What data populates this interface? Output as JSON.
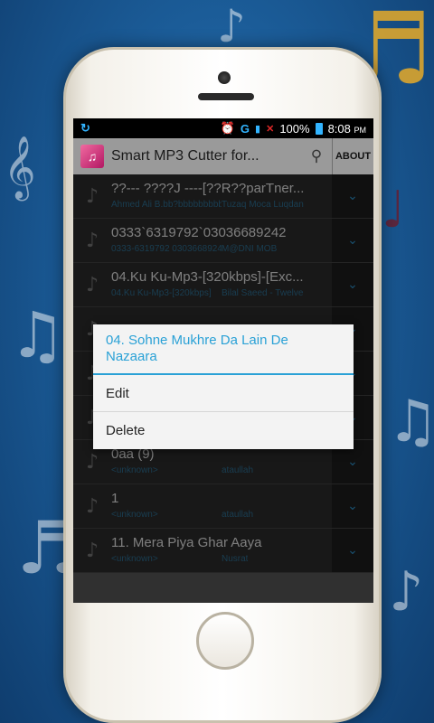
{
  "status_bar": {
    "sync_icon": "sync-icon",
    "alarm_icon": "alarm-icon",
    "network": "G",
    "battery_percent": "100%",
    "time": "8:08",
    "ampm": "PM"
  },
  "action_bar": {
    "app_icon": "music-app-icon",
    "title": "Smart MP3 Cutter for...",
    "search_icon": "search-icon",
    "about_label": "ABOUT"
  },
  "songs": [
    {
      "title": "??--- ????J ----[??R??parTner...",
      "album": "Ahmed Ali B.bb?bbbbbbbbbb",
      "artist": "Tuzaq Moca Luqdan"
    },
    {
      "title": "0333`6319792`03036689242",
      "album": "0333-6319792 03036689242",
      "artist": "M@DNI MOB"
    },
    {
      "title": "04.Ku Ku-Mp3-[320kbps]-[Exc...",
      "album": "04.Ku Ku-Mp3-[320kbps]",
      "artist": "Bilal Saeed - Twelve"
    },
    {
      "title": "",
      "album": "",
      "artist": ""
    },
    {
      "title": "",
      "album": "",
      "artist": ""
    },
    {
      "title": "",
      "album": "",
      "artist": ""
    },
    {
      "title": "0aa (9)",
      "album": "<unknown>",
      "artist": "ataullah"
    },
    {
      "title": "1",
      "album": "<unknown>",
      "artist": "ataullah"
    },
    {
      "title": "11. Mera Piya Ghar Aaya",
      "album": "<unknown>",
      "artist": "Nusrat"
    }
  ],
  "dialog": {
    "title": "04. Sohne Mukhre Da Lain De Nazaara",
    "edit_label": "Edit",
    "delete_label": "Delete"
  }
}
